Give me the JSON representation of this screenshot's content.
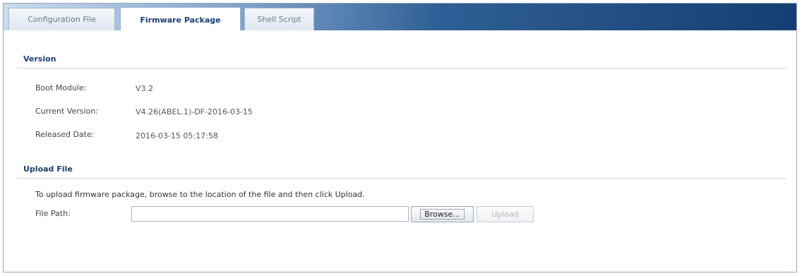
{
  "tabs": [
    {
      "label": "Configuration File",
      "active": false
    },
    {
      "label": "Firmware Package",
      "active": true
    },
    {
      "label": "Shell Script",
      "active": false
    }
  ],
  "version": {
    "title": "Version",
    "fields": [
      {
        "label": "Boot Module:",
        "value": "V3.2"
      },
      {
        "label": "Current Version:",
        "value": "V4.26(ABEL.1)-DF-2016-03-15"
      },
      {
        "label": "Released Date:",
        "value": "2016-03-15 05:17:58"
      }
    ]
  },
  "upload": {
    "title": "Upload File",
    "instruction": "To upload firmware package, browse to the location of the file and then click Upload.",
    "file_path_label": "File Path:",
    "file_path_value": "",
    "browse_label": "Browse...",
    "upload_label": "Upload",
    "upload_enabled": false
  },
  "colors": {
    "accent": "#1d3f72",
    "tabbar_dark": "#153e73",
    "tabbar_light": "#c9dcef"
  }
}
